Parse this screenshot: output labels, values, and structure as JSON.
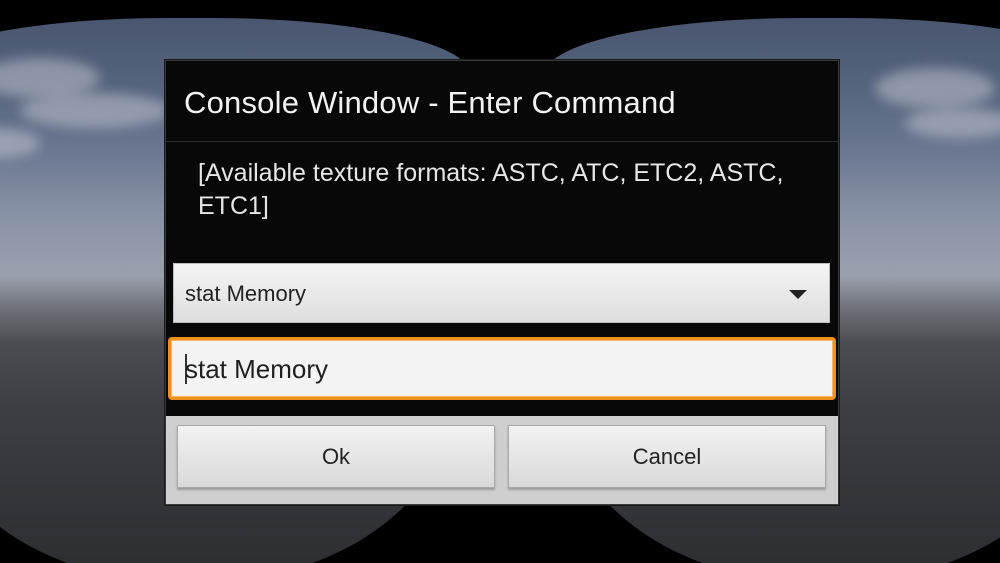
{
  "dialog": {
    "title": "Console Window - Enter Command",
    "message": "[Available texture formats: ASTC, ATC, ETC2, ASTC, ETC1]",
    "history_dropdown": {
      "selected_value": "stat Memory",
      "icon": "chevron-down-icon"
    },
    "command_input": {
      "value": "stat Memory"
    },
    "buttons": {
      "ok_label": "Ok",
      "cancel_label": "Cancel"
    }
  },
  "colors": {
    "dialog_background": "#080808",
    "input_focus_border": "#f0901c",
    "button_background": "#e6e6e6",
    "button_bar": "#cfcfcf"
  }
}
